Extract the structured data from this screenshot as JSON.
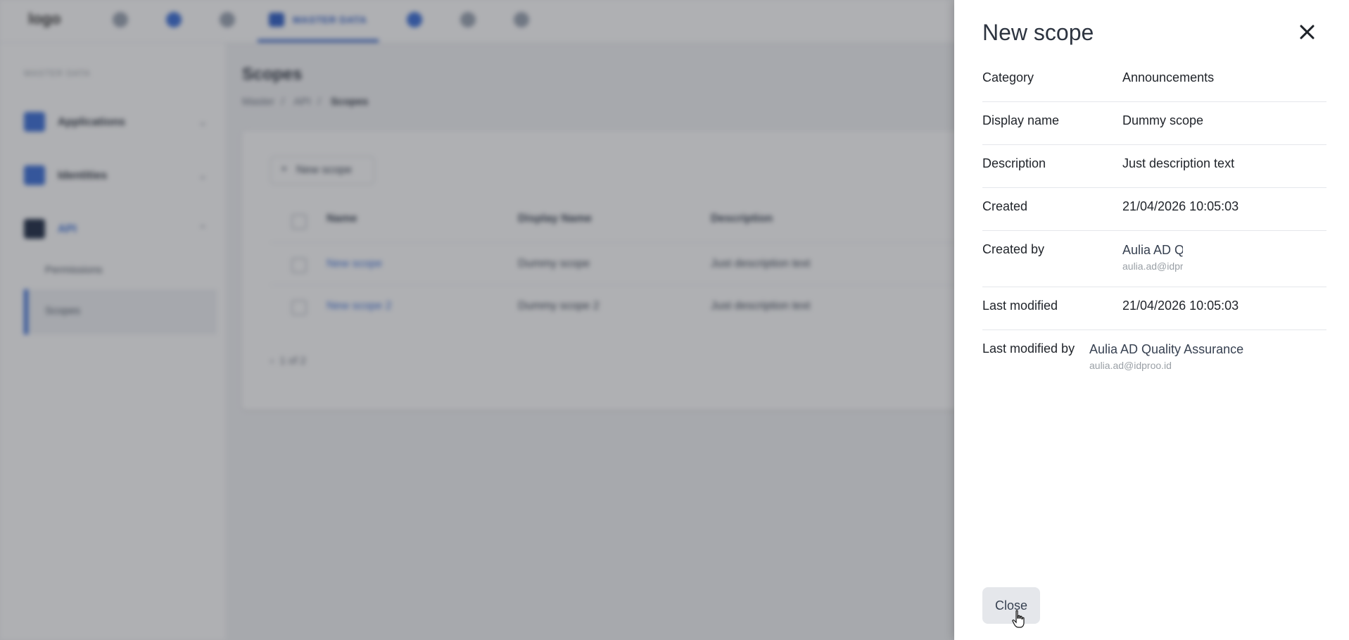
{
  "app": {
    "logo_text": "logo",
    "active_tab": "MASTER DATA"
  },
  "sidebar": {
    "heading": "MASTER DATA",
    "items": [
      {
        "label": "Applications"
      },
      {
        "label": "Identities"
      },
      {
        "label": "API"
      }
    ],
    "sub_items": [
      {
        "label": "Permissions"
      },
      {
        "label": "Scopes"
      }
    ]
  },
  "page": {
    "title": "Scopes",
    "breadcrumb": [
      "Master",
      "API",
      "Scopes"
    ],
    "new_button_label": "New scope",
    "columns": [
      "Name",
      "Display Name",
      "Description"
    ],
    "rows": [
      {
        "name": "New scope",
        "display_name": "Dummy scope",
        "description": "Just description text"
      },
      {
        "name": "New scope 2",
        "display_name": "Dummy scope 2",
        "description": "Just description text"
      }
    ],
    "pagination": "1 of 2"
  },
  "drawer": {
    "title": "New scope",
    "fields": {
      "category": {
        "label": "Category",
        "value": "Announcements"
      },
      "display_name": {
        "label": "Display name",
        "value": "Dummy scope"
      },
      "description": {
        "label": "Description",
        "value": "Just description text"
      },
      "created": {
        "label": "Created",
        "value": "21/04/2026 10:05:03"
      },
      "created_by": {
        "label": "Created by",
        "name": "Aulia AD Quality Assurance",
        "email": "aulia.ad@idproo.id"
      },
      "last_modified": {
        "label": "Last modified",
        "value": "21/04/2026 10:05:03"
      },
      "last_modified_by": {
        "label": "Last modified by",
        "name": "Aulia AD Quality Assurance",
        "email": "aulia.ad@idproo.id"
      }
    },
    "close_button_label": "Close"
  }
}
